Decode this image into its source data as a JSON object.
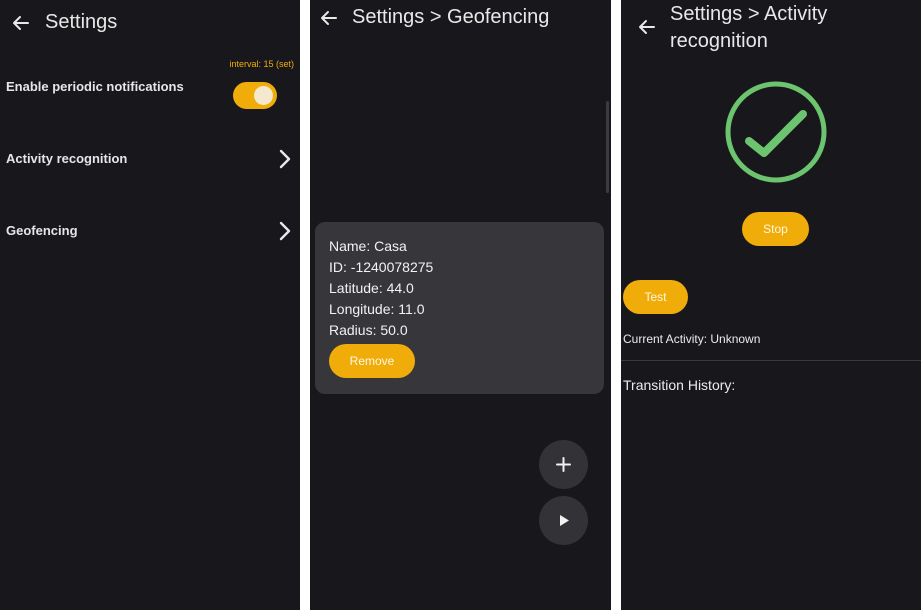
{
  "panel1": {
    "title": "Settings",
    "interval_text": "interval: 15 (set)",
    "rows": [
      {
        "label": "Enable periodic notifications"
      },
      {
        "label": "Activity recognition"
      },
      {
        "label": "Geofencing"
      }
    ],
    "toggle_on": true
  },
  "panel2": {
    "title": "Settings > Geofencing",
    "card": {
      "name": "Name: Casa",
      "id": "ID: -1240078275",
      "latitude": "Latitude: 44.0",
      "longitude": "Longitude: 11.0",
      "radius": "Radius: 50.0",
      "remove_label": "Remove"
    },
    "fab_add_icon": "plus-icon",
    "fab_play_icon": "play-icon"
  },
  "panel3": {
    "title": "Settings > Activity recognition",
    "status_icon": "check-circle-icon",
    "stop_label": "Stop",
    "test_label": "Test",
    "current_activity": "Current Activity: Unknown",
    "transition_history": "Transition History:"
  },
  "colors": {
    "background": "#18181c",
    "accent": "#f0ad0a",
    "card": "#37373b",
    "success": "#6cc46f"
  }
}
